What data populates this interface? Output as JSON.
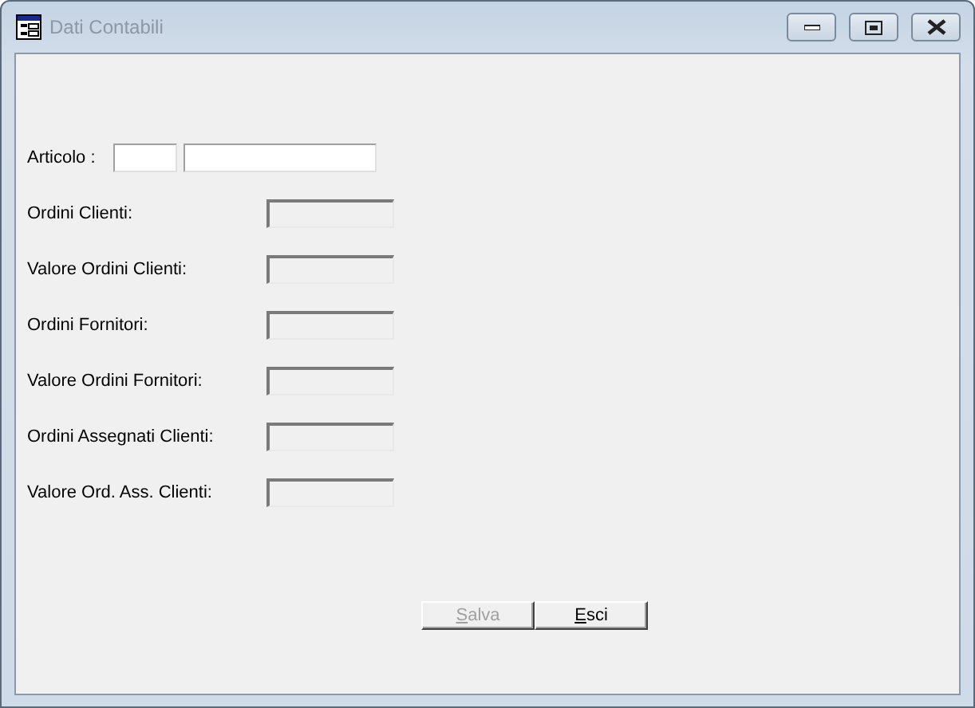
{
  "window": {
    "title": "Dati Contabili",
    "active": false
  },
  "articolo": {
    "label": "Articolo :"
  },
  "fields": [
    {
      "label": "Ordini Clienti:",
      "disabled": true
    },
    {
      "label": "Valore Ordini Clienti:",
      "disabled": true
    },
    {
      "label": "Ordini Fornitori:",
      "disabled": true
    },
    {
      "label": "Valore Ordini Fornitori:",
      "disabled": true
    },
    {
      "label": "Ordini Assegnati Clienti:",
      "disabled": true
    },
    {
      "label": "Valore Ord. Ass. Clienti:",
      "disabled": true
    }
  ],
  "buttons": [
    {
      "label": "Salva",
      "disabled": true,
      "mnemonic_first": true
    },
    {
      "label": "Esci",
      "disabled": false,
      "mnemonic_first": true
    }
  ]
}
